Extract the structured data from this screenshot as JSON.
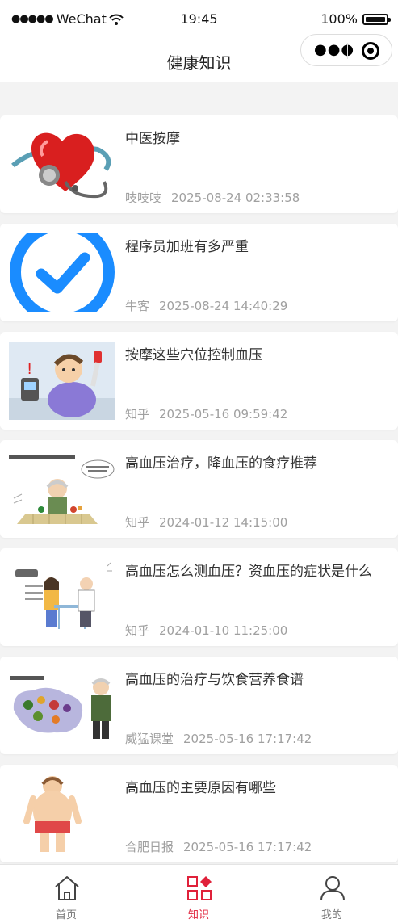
{
  "status_bar": {
    "carrier": "WeChat",
    "time": "19:45",
    "battery": "100%"
  },
  "nav": {
    "title": "健康知识"
  },
  "articles": [
    {
      "title": "中医按摩",
      "source": "吱吱吱",
      "date": "2025-08-24 02:33:58",
      "image": "heart-stethoscope"
    },
    {
      "title": "程序员加班有多严重",
      "source": "牛客",
      "date": "2025-08-24 14:40:29",
      "image": "blue-checkmark"
    },
    {
      "title": "按摩这些穴位控制血压",
      "source": "知乎",
      "date": "2025-05-16 09:59:42",
      "image": "blood-pressure-cartoon"
    },
    {
      "title": "高血压治疗，降血压的食疗推荐",
      "source": "知乎",
      "date": "2024-01-12 14:15:00",
      "image": "elder-food-cartoon"
    },
    {
      "title": "高血压怎么测血压？资血压的症状是什么",
      "source": "知乎",
      "date": "2024-01-10 11:25:00",
      "image": "doctor-patient-cartoon"
    },
    {
      "title": "高血压的治疗与饮食营养食谱",
      "source": "威猛课堂",
      "date": "2025-05-16 17:17:42",
      "image": "vegetables-elder-cartoon"
    },
    {
      "title": "高血压的主要原因有哪些",
      "source": "合肥日报",
      "date": "2025-05-16 17:17:42",
      "image": "overweight-person-cartoon"
    }
  ],
  "tab_bar": {
    "items": [
      {
        "label": "首页",
        "icon": "home-icon",
        "active": false
      },
      {
        "label": "知识",
        "icon": "knowledge-grid-icon",
        "active": true
      },
      {
        "label": "我的",
        "icon": "user-icon",
        "active": false
      }
    ],
    "active_color": "#e0213a"
  }
}
